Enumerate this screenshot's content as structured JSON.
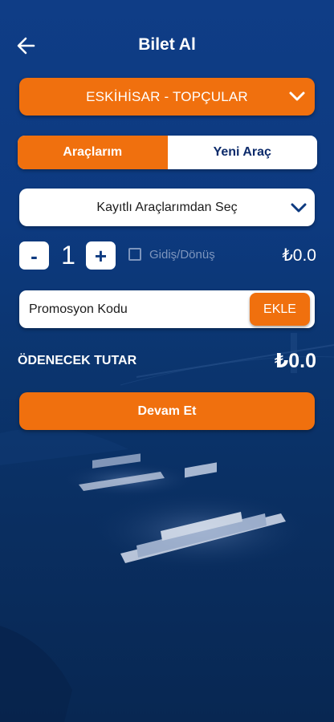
{
  "header": {
    "title": "Bilet Al",
    "back_icon": "arrow-left-icon"
  },
  "route": {
    "selected": "ESKİHİSAR - TOPÇULAR",
    "icon": "chevron-down-icon"
  },
  "tabs": [
    {
      "label": "Araçlarım",
      "active": true
    },
    {
      "label": "Yeni Araç",
      "active": false
    }
  ],
  "vehicle_select": {
    "label": "Kayıtlı Araçlarımdan Seç",
    "icon": "chevron-down-icon"
  },
  "quantity": {
    "minus": "-",
    "plus": "+",
    "value": "1",
    "round_trip_label": "Gidiş/Dönüş",
    "round_trip_checked": false,
    "price": "₺0.0"
  },
  "promo": {
    "placeholder": "Promosyon Kodu",
    "value": "",
    "button": "EKLE"
  },
  "total": {
    "label": "ÖDENECEK TUTAR",
    "value": "₺0.0"
  },
  "continue_button": "Devam Et",
  "colors": {
    "accent": "#f0700e",
    "background": "#0d3a80",
    "text_dark": "#0d2b6b"
  }
}
